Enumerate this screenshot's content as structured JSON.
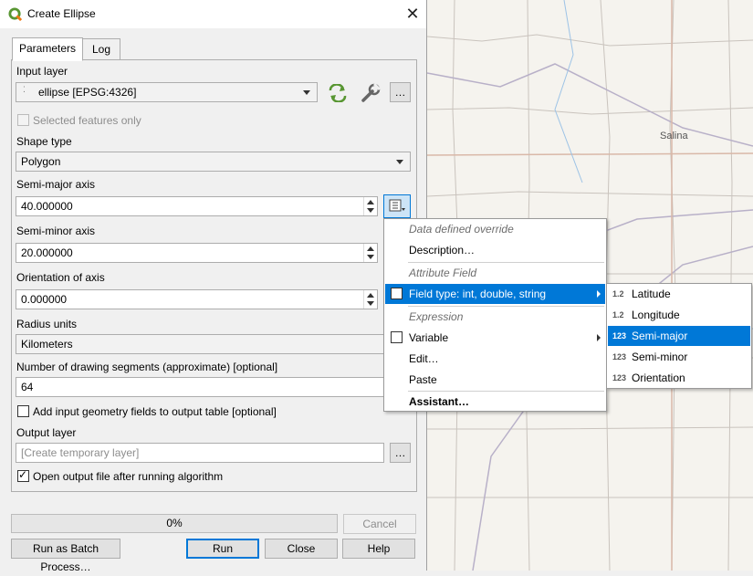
{
  "window": {
    "title": "Create Ellipse",
    "close_glyph": "✕"
  },
  "tabs": [
    {
      "label": "Parameters"
    },
    {
      "label": "Log"
    }
  ],
  "input_layer": {
    "label": "Input layer",
    "value": "ellipse [EPSG:4326]",
    "browse": "…"
  },
  "selected_only": {
    "label": "Selected features only"
  },
  "shape_type": {
    "label": "Shape type",
    "value": "Polygon"
  },
  "semi_major": {
    "label": "Semi-major axis",
    "value": "40.000000"
  },
  "semi_minor": {
    "label": "Semi-minor axis",
    "value": "20.000000"
  },
  "orientation": {
    "label": "Orientation of axis",
    "value": "0.000000"
  },
  "radius_units": {
    "label": "Radius units",
    "value": "Kilometers"
  },
  "segments": {
    "label": "Number of drawing segments (approximate) [optional]",
    "value": "64"
  },
  "add_geom": {
    "label": "Add input geometry fields to output table [optional]"
  },
  "output": {
    "label": "Output layer",
    "placeholder": "[Create temporary layer]",
    "browse": "…"
  },
  "open_output": {
    "label": "Open output file after running algorithm"
  },
  "progress": {
    "text": "0%",
    "value": 0
  },
  "buttons": {
    "cancel": "Cancel",
    "batch": "Run as Batch Process…",
    "run": "Run",
    "close": "Close",
    "help": "Help"
  },
  "context_menu": {
    "header1": "Data defined override",
    "description": "Description…",
    "header2": "Attribute Field",
    "field_type": "Field type: int, double, string",
    "header3": "Expression",
    "variable": "Variable",
    "edit": "Edit…",
    "paste": "Paste",
    "assistant": "Assistant…"
  },
  "submenu": [
    {
      "type": "1.2",
      "label": "Latitude"
    },
    {
      "type": "1.2",
      "label": "Longitude"
    },
    {
      "type": "123",
      "label": "Semi-major"
    },
    {
      "type": "123",
      "label": "Semi-minor"
    },
    {
      "type": "123",
      "label": "Orientation"
    }
  ],
  "map": {
    "city": "Salina"
  },
  "colors": {
    "highlight": "#0078d7",
    "qgis_green": "#589632",
    "map_bg": "#f5f3ee"
  }
}
